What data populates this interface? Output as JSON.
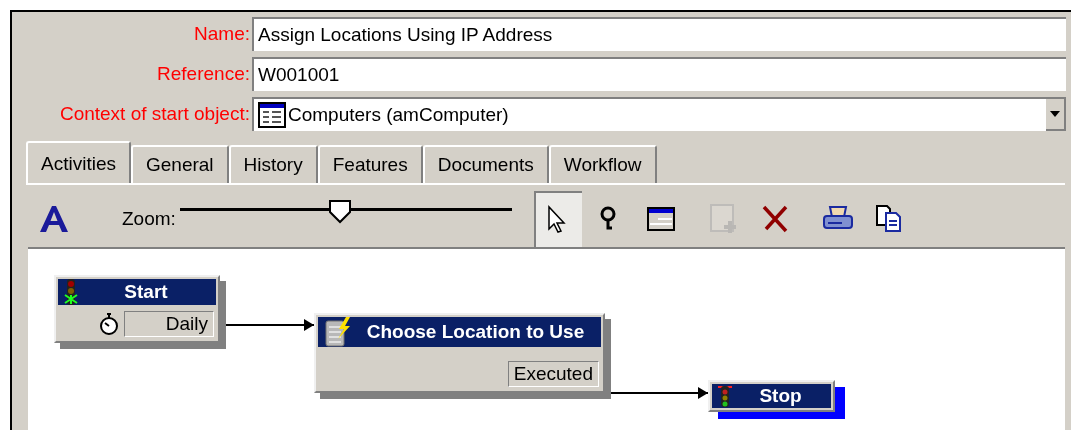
{
  "form": {
    "fields": [
      {
        "label": "Name:",
        "value": "Assign Locations Using IP Address",
        "kind": "text"
      },
      {
        "label": "Reference:",
        "value": "W001001",
        "kind": "text"
      },
      {
        "label": "Context of start object:",
        "value": "Computers (amComputer)",
        "kind": "dropdown"
      }
    ]
  },
  "tabs": [
    {
      "label": "Activities",
      "selected": true
    },
    {
      "label": "General",
      "selected": false
    },
    {
      "label": "History",
      "selected": false
    },
    {
      "label": "Features",
      "selected": false
    },
    {
      "label": "Documents",
      "selected": false
    },
    {
      "label": "Workflow",
      "selected": false
    }
  ],
  "toolbar": {
    "zoom_label": "Zoom:",
    "zoom": {
      "level": 0.48
    },
    "tools": [
      {
        "kind": "pointer",
        "selected": true,
        "disabled": false
      },
      {
        "kind": "zoom",
        "selected": false,
        "disabled": false
      },
      {
        "kind": "window",
        "selected": false,
        "disabled": false
      },
      {
        "kind": "add",
        "selected": false,
        "disabled": true
      },
      {
        "kind": "delete",
        "selected": false,
        "disabled": false
      },
      {
        "kind": "print",
        "selected": false,
        "disabled": false
      },
      {
        "kind": "copy",
        "selected": false,
        "disabled": false
      }
    ]
  },
  "diagram": {
    "nodes": [
      {
        "kind": "start",
        "title": "Start",
        "status": "Daily",
        "selected": false
      },
      {
        "kind": "activity",
        "title": "Choose Location to Use",
        "status": "Executed",
        "selected": false
      },
      {
        "kind": "stop",
        "title": "Stop",
        "selected": true
      }
    ]
  }
}
